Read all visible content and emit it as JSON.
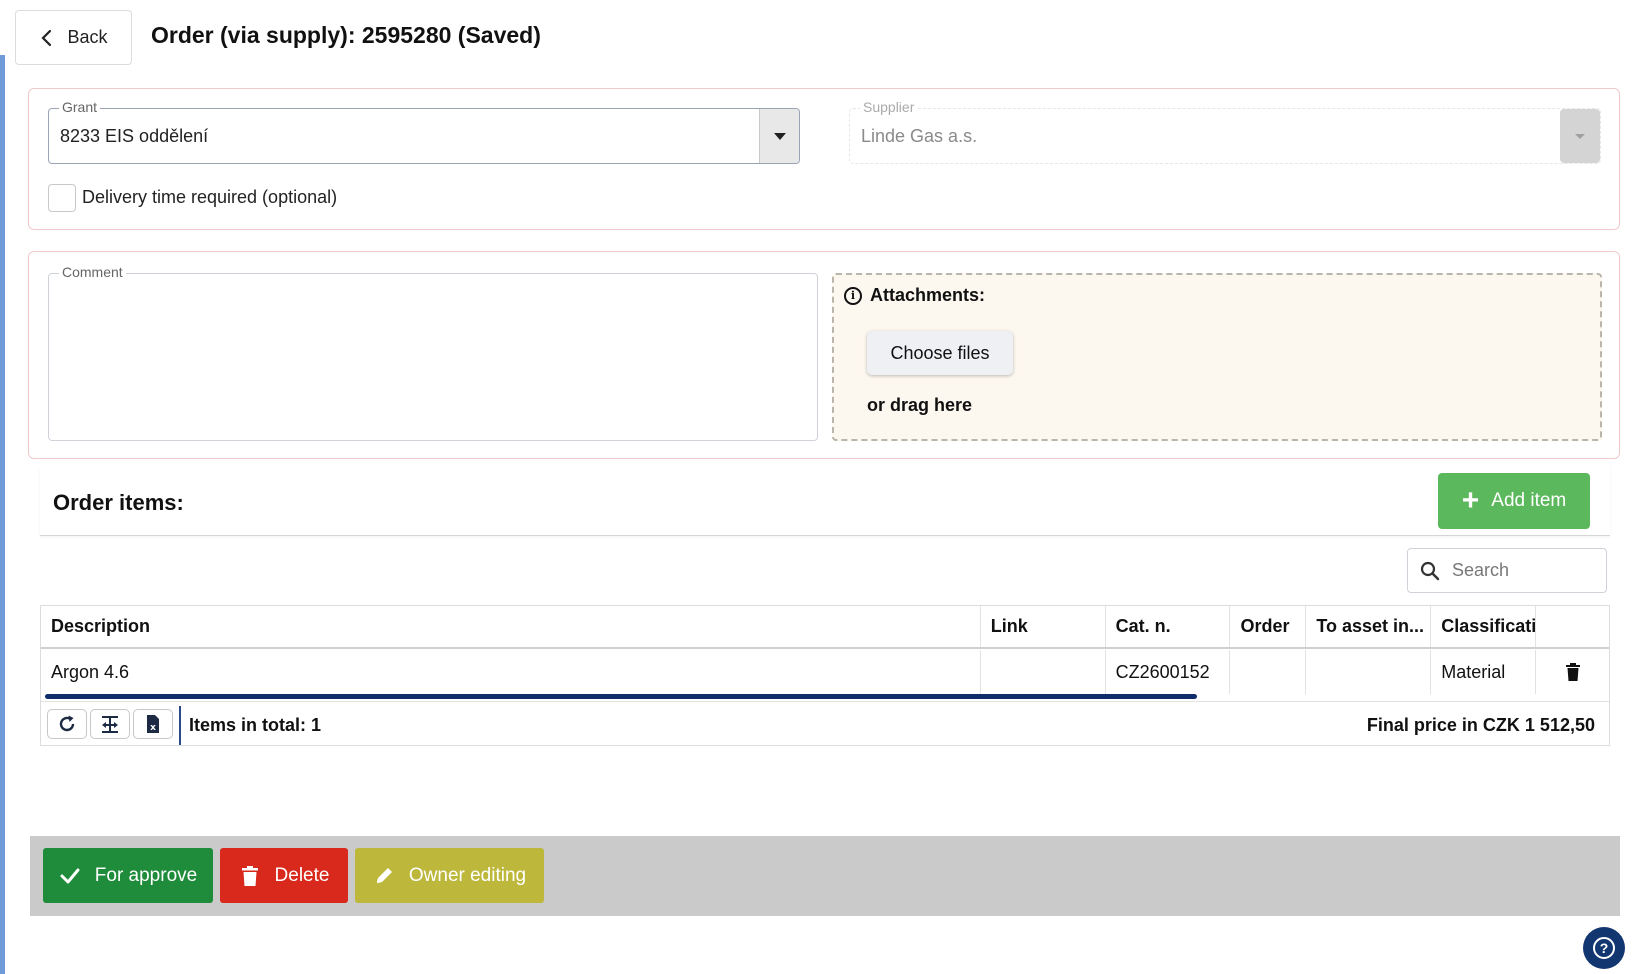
{
  "header": {
    "back_label": "Back",
    "title": "Order (via supply): 2595280 (Saved)"
  },
  "general": {
    "grant": {
      "legend": "Grant",
      "value": "8233 EIS oddělení"
    },
    "supplier": {
      "legend": "Supplier",
      "value": "Linde Gas a.s."
    },
    "delivery_checkbox": {
      "label": "Delivery time required (optional)",
      "checked": false
    }
  },
  "comment": {
    "legend": "Comment",
    "value": ""
  },
  "attachments": {
    "title": "Attachments:",
    "choose_label": "Choose files",
    "drag_label": "or drag here"
  },
  "items": {
    "title": "Order items:",
    "add_label": "Add item",
    "search_placeholder": "Search",
    "columns": [
      "Description",
      "Link",
      "Cat. n.",
      "Order",
      "To asset in...",
      "Classificati..."
    ],
    "rows": [
      {
        "description": "Argon 4.6",
        "link": "",
        "cat_n": "CZ2600152",
        "order": "",
        "to_asset": "",
        "classification": "Material"
      }
    ],
    "footer": {
      "items_total": "Items in total: 1",
      "final_price": "Final price in CZK 1 512,50"
    }
  },
  "actions": {
    "approve_label": "For approve",
    "delete_label": "Delete",
    "owner_label": "Owner editing"
  },
  "colors": {
    "approve": "#1e8c3a",
    "delete": "#d9281c",
    "owner": "#bdb73c",
    "add_item": "#5cb85c",
    "help": "#12366f"
  }
}
